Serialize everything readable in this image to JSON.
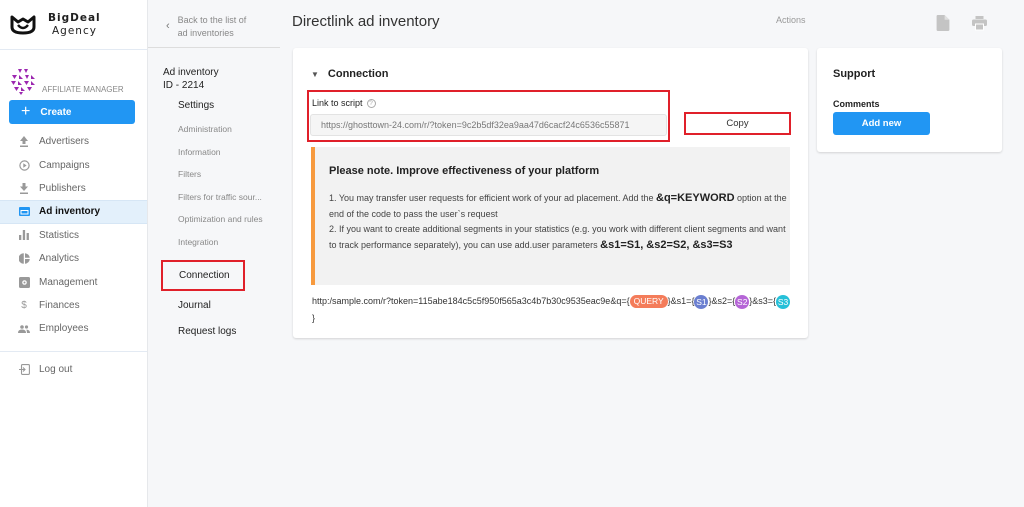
{
  "brand": {
    "line1": "BigDeal",
    "line2": "Agency"
  },
  "role": {
    "label": "AFFILIATE MANAGER"
  },
  "sidebar": {
    "create_label": "Create",
    "items": [
      {
        "label": "Advertisers",
        "icon": "upload-icon"
      },
      {
        "label": "Campaigns",
        "icon": "play-circle-icon"
      },
      {
        "label": "Publishers",
        "icon": "download-icon"
      },
      {
        "label": "Ad inventory",
        "icon": "ad-window-icon",
        "active": true
      },
      {
        "label": "Statistics",
        "icon": "bar-chart-icon"
      },
      {
        "label": "Analytics",
        "icon": "pie-chart-icon"
      },
      {
        "label": "Management",
        "icon": "settings-box-icon"
      },
      {
        "label": "Finances",
        "icon": "dollar-icon"
      },
      {
        "label": "Employees",
        "icon": "people-icon"
      }
    ],
    "logout_label": "Log out"
  },
  "subnav": {
    "back_line1": "Back to the list of",
    "back_line2": "ad inventories",
    "inventory_label": "Ad inventory",
    "inventory_id": "ID - 2214",
    "settings_label": "Settings",
    "settings_items": [
      "Administration",
      "Information",
      "Filters",
      "Filters for traffic sour...",
      "Optimization and rules",
      "Integration"
    ],
    "connection_label": "Connection",
    "journal_label": "Journal",
    "request_logs_label": "Request logs"
  },
  "header": {
    "title": "Directlink ad inventory",
    "actions_label": "Actions"
  },
  "connection": {
    "section_title": "Connection",
    "link_label": "Link to script",
    "link_value": "https://ghosttown-24.com/r/?token=9c2b5df32ea9aa47d6cacf24c6536c55871",
    "copy_label": "Copy",
    "note_title": "Please note. Improve effectiveness of your platform",
    "note_p1a": "1. You may transfer user requests for efficient work of your ad placement. Add the ",
    "note_p1b": "&q=KEYWORD",
    "note_p1c": " option at the end of the code to pass the user`s request",
    "note_p2a": "2. If you want to create additional segments in your statistics (e.g. you work with different client segments and want to track performance separately), you can use add.user parameters ",
    "note_p2b": "&s1=S1, &s2=S2, &s3=S3",
    "sample_prefix": "http:/sample.com/r?token=115abe184c5c5f950f565a3c4b7b30c9535eac9e&q={",
    "query_pill": "QUERY",
    "sample_s1": "}&s1={",
    "s1_pill": "S1",
    "sample_s2": "}&s2={",
    "s2_pill": "S2",
    "sample_s3": "}&s3={",
    "s3_pill": "S3",
    "sample_end": "}"
  },
  "colors": {
    "accent": "#2196f3",
    "highlight": "#e0202a",
    "note_border": "#f79a3e",
    "query": "#f47c5a",
    "s1": "#6b7fd0",
    "s2": "#b565d6",
    "s3": "#26c0d8"
  },
  "support": {
    "title": "Support",
    "comments_label": "Comments",
    "add_label": "Add new"
  }
}
